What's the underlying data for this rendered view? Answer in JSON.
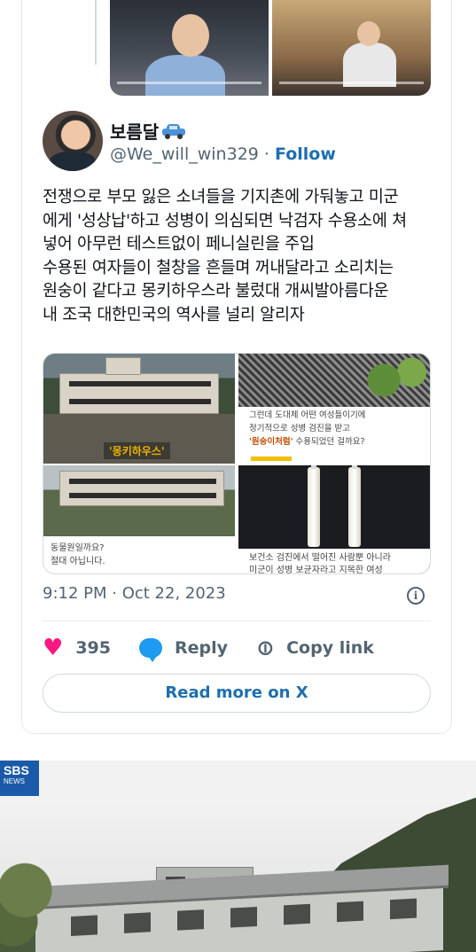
{
  "author": {
    "display_name": "보름달",
    "handle": "@We_will_win329",
    "separator": " · ",
    "follow_label": "Follow"
  },
  "tweet": {
    "text": "전쟁으로 부모 잃은 소녀들을 기지촌에 가둬놓고 미군\n에게 '성상납'하고 성병이 의심되면 낙검자 수용소에 쳐\n넣어  아무런 테스트없이 페니실린을 주입\n수용된 여자들이 철창을 흔들며 꺼내달라고 소리치는\n원숭이 같다고 몽키하우스라 불렀대 개씨발아름다운\n내 조국 대한민국의 역사를 널리 알리자",
    "timestamp": "9:12 PM · Oct 22, 2023",
    "info_glyph": "i"
  },
  "media": {
    "label_monkey_house": "'몽키하우스'",
    "caption_top_right_1": "그런데 도대체 어떤 여성들이기에",
    "caption_top_right_2": "정기적으로 성병 검진을 받고",
    "caption_top_right_bold": "'원숭이처럼'",
    "caption_top_right_3": " 수용되었던 걸까요?",
    "caption_bottom_left": "동물원일까요?\n절대 아닙니다.",
    "caption_bottom_right": "보건소 검진에서 떨어진 사람뿐 아니라\n미군이 성병 보균자라고 지목한 여성"
  },
  "actions": {
    "like_icon": "heart-icon",
    "like_count": "395",
    "reply_label": "Reply",
    "copy_link_label": "Copy link"
  },
  "read_more_label": "Read more on X",
  "news_image": {
    "logo_line1": "SBS",
    "logo_line2": "NEWS"
  },
  "colors": {
    "link_blue": "#1d6fb0",
    "like_pink": "#f91880",
    "reply_blue": "#1d9bf0",
    "muted_gray": "#536471",
    "sbs_blue": "#1a5aa8"
  }
}
